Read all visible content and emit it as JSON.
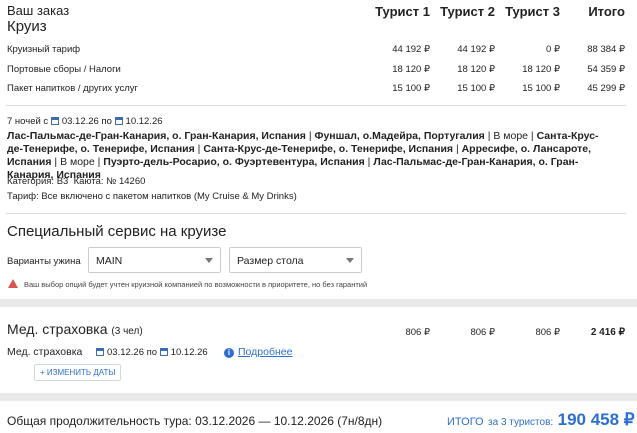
{
  "order": {
    "title": "Ваш заказ",
    "columns": [
      "Турист 1",
      "Турист 2",
      "Турист 3",
      "Итого"
    ]
  },
  "cruise": {
    "heading": "Круиз",
    "rows": [
      {
        "label": "Круизный тариф",
        "values": [
          "44 192 ₽",
          "44 192 ₽",
          "0 ₽",
          "88 384 ₽"
        ]
      },
      {
        "label": "Портовые сборы / Налоги",
        "values": [
          "18 120 ₽",
          "18 120 ₽",
          "18 120 ₽",
          "54 359 ₽"
        ]
      },
      {
        "label": "Пакет напитков / других услуг",
        "values": [
          "15 100 ₽",
          "15 100 ₽",
          "15 100 ₽",
          "45 299 ₽"
        ]
      }
    ],
    "nights": "7 ночей с",
    "date_from": "03.12.26",
    "date_to_prefix": "по",
    "date_to": "10.12.26",
    "route": [
      "Лас-Пальмас-де-Гран-Канария, о. Гран-Канария, Испания",
      "Фуншал, о.Мадейра, Португалия",
      "В море",
      "Санта-Крус-де-Тенерифе, о. Тенерифе, Испания",
      "Санта-Крус-де-Тенерифе, о. Тенерифе, Испания",
      "Арресифе, о. Лансароте, Испания",
      "В море",
      "Пуэрто-дель-Росарио, о. Фуэртевентура, Испания",
      "Лас-Пальмас-де-Гран-Канария, о. Гран-Канария, Испания"
    ],
    "route_separator": " | ",
    "category": "Категория: B3",
    "cabin": "Каюта: № 14260",
    "tariff": "Тариф: Все включено с пакетом напитков (My Cruise & My Drinks)"
  },
  "special": {
    "heading": "Специальный сервис на круизе",
    "dinner_label": "Варианты ужина",
    "dinner_value": "MAIN",
    "table_placeholder": "Размер стола",
    "warning": "Ваш выбор опций будет учтен круизной компанией по возможности в приоритете, но без гарантий"
  },
  "insurance": {
    "heading": "Мед. страховка",
    "people": "(3 чел)",
    "values": [
      "806 ₽",
      "806 ₽",
      "806 ₽",
      "2 416 ₽"
    ],
    "label": "Мед. страховка",
    "date_from": "03.12.26",
    "date_to_prefix": "по",
    "date_to": "10.12.26",
    "details_link": "Подробнее",
    "change_dates": "ИЗМЕНИТЬ ДАТЫ",
    "plus": "+"
  },
  "footer": {
    "duration_label": "Общая продолжительность тура: 03.12.2026 — 10.12.2026 (7н/8дн)",
    "total_label": "ИТОГО",
    "total_suffix": "за 3 туристов:",
    "total_value": "190 458 ₽"
  },
  "colors": {
    "accent": "#2d6fd1",
    "warning": "#d9534f"
  }
}
